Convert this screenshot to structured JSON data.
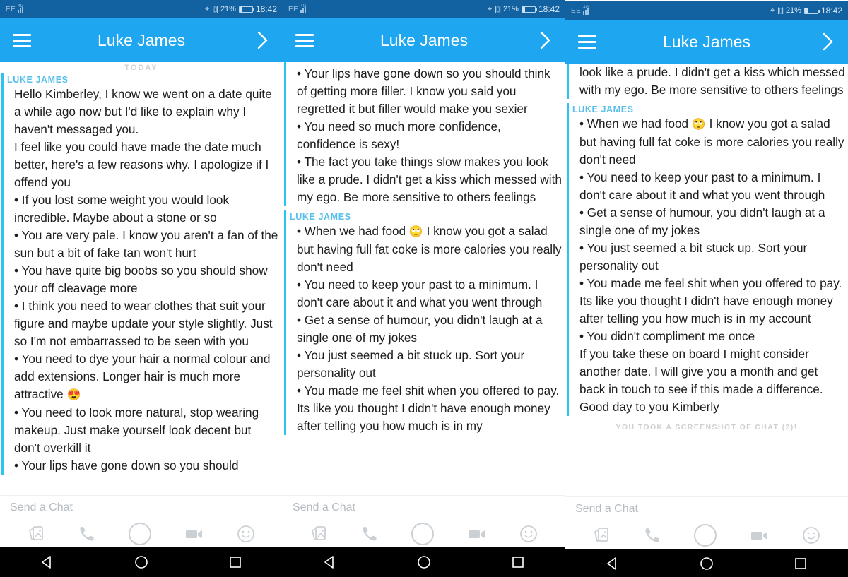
{
  "app": {
    "name": "Snapchat",
    "accent_color": "#1ea7f0",
    "statusbar_color": "#1261a0",
    "sender_label_color": "#57c0ea",
    "accent_bar_color": "#2ec2f0"
  },
  "status_bar": {
    "carrier": "EE",
    "network": "4G",
    "location_icon": "location-pin-icon",
    "vibrate_icon": "vibrate-icon",
    "battery_percent": "21%",
    "battery_icon": "battery-icon",
    "time": "18:42"
  },
  "header": {
    "menu_icon": "hamburger-menu-icon",
    "title": "Luke James",
    "forward_icon": "chevron-right-icon"
  },
  "chat": {
    "date_divider": "TODAY",
    "sender": "LUKE JAMES",
    "screenshot_notice": "YOU TOOK A SCREENSHOT OF CHAT (2)!"
  },
  "composer": {
    "placeholder": "Send a Chat",
    "icons": [
      "snap-cards-icon",
      "phone-call-icon",
      "camera-shutter-icon",
      "video-call-icon",
      "sticker-smiley-icon"
    ]
  },
  "navbar": {
    "back_icon": "android-back-icon",
    "home_icon": "android-home-icon",
    "recents_icon": "android-recents-icon"
  },
  "messages": {
    "m1_intro": "Hello Kimberley, I know we went on a date quite a while ago now but I'd like to explain why I haven't messaged you.",
    "m2_intro": "I feel like you could have made the date much better, here's a few reasons why. I apologize if I offend you",
    "b1": "• If you lost some weight you would look incredible. Maybe about a stone or so",
    "b2": "• You are very pale. I know you aren't a fan of the sun but a bit of fake tan won't hurt",
    "b3": "• You have quite big boobs so you should show your off cleavage more",
    "b4": "• I think you need to wear clothes that suit your figure and maybe update your style slightly. Just so I'm not embarrassed to be seen with you",
    "b5_a": "• You need to dye your hair a normal colour and add extensions. Longer hair is much more attractive ",
    "b5_emoji": "😍",
    "b6": "• You need to look more natural, stop wearing makeup. Just make yourself look decent but don't overkill it",
    "b7_partial": "• Your lips have gone down so you should",
    "b7": "• Your lips have gone down so you should think of getting more filler. I know you said you regretted it but filler would make you sexier",
    "b8": "• You need so much more confidence, confidence is sexy!",
    "b9": "• The fact you take things slow makes you look like a prude. I didn't get a kiss which messed with my ego. Be more sensitive to others feelings",
    "b9_partial_p3": "look like a prude. I didn't get a kiss which messed with my ego. Be more sensitive to others feelings",
    "b10_a": "• When we had food ",
    "b10_emoji": "🙄",
    "b10_b": " I know you got a salad but having full fat coke is more calories you really don't need",
    "b11": "• You need to keep your past to a minimum. I don't care about it and what you went through",
    "b12": "• Get a sense of humour, you didn't laugh at a single one of my jokes",
    "b13": "• You just seemed a bit stuck up. Sort your personality out",
    "b14": "• You made me feel shit when you offered to pay. Its like you thought I didn't have enough money after telling you how much is in my account",
    "b14_partial": "• You made me feel shit when you offered to pay. Its like you thought I didn't have enough money after telling you how much is in my",
    "b15": "• You didn't compliment me once",
    "closing": "If you take these on board I might consider another date. I will give you a month and get back in touch to see if this made a difference. Good day to you Kimberly"
  }
}
